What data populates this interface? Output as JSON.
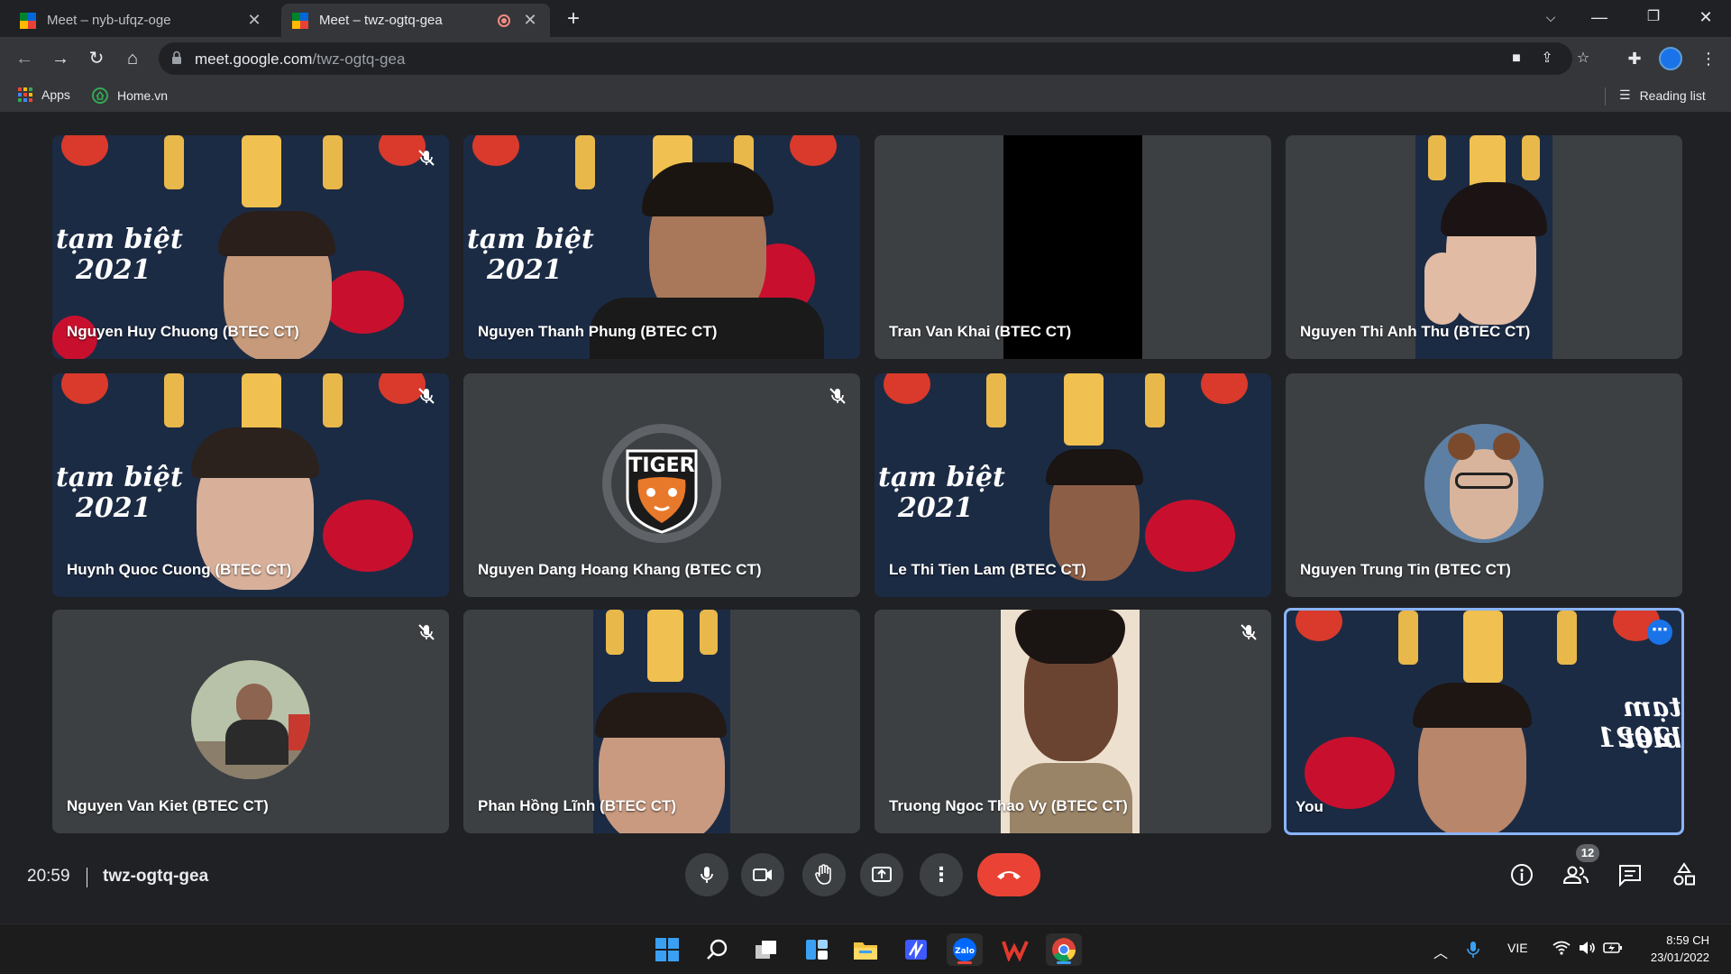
{
  "browser": {
    "tabs": [
      {
        "title": "Meet – nyb-ufqz-oge",
        "active": false
      },
      {
        "title": "Meet – twz-ogtq-gea",
        "active": true
      }
    ],
    "new_tab": "+",
    "url_host": "meet.google.com",
    "url_path": "/twz-ogtq-gea",
    "bookmarks": [
      {
        "label": "Apps"
      },
      {
        "label": "Home.vn"
      }
    ],
    "reading_list": "Reading list"
  },
  "meet": {
    "participants": [
      {
        "name": "Nguyen Huy Chuong (BTEC CT)",
        "muted": true,
        "kind": "festive"
      },
      {
        "name": "Nguyen Thanh Phung (BTEC CT)",
        "muted": false,
        "kind": "festive"
      },
      {
        "name": "Tran Van Khai (BTEC CT)",
        "muted": false,
        "kind": "black"
      },
      {
        "name": "Nguyen Thi Anh Thu (BTEC CT)",
        "muted": false,
        "kind": "narrow-festive"
      },
      {
        "name": "Huynh Quoc Cuong (BTEC CT)",
        "muted": true,
        "kind": "festive"
      },
      {
        "name": "Nguyen Dang Hoang Khang (BTEC CT)",
        "muted": true,
        "kind": "avatar-tiger"
      },
      {
        "name": "Le Thi Tien Lam (BTEC CT)",
        "muted": false,
        "kind": "festive"
      },
      {
        "name": "Nguyen Trung Tin (BTEC CT)",
        "muted": false,
        "kind": "avatar-photo"
      },
      {
        "name": "Nguyen Van Kiet (BTEC CT)",
        "muted": true,
        "kind": "avatar-photo"
      },
      {
        "name": "Phan Hồng Lĩnh (BTEC CT)",
        "muted": false,
        "kind": "narrow-festive"
      },
      {
        "name": "Truong Ngoc Thao Vy (BTEC CT)",
        "muted": true,
        "kind": "narrow-photo"
      },
      {
        "name": "You",
        "muted": false,
        "kind": "self"
      }
    ],
    "festive_text": [
      "tạm biệt",
      "2021"
    ],
    "tiger_logo_text": "TIGER",
    "clock": "20:59",
    "meeting_code": "twz-ogtq-gea",
    "participant_count": "12",
    "colors": {
      "accent": "#8ab4f8",
      "hangup": "#ea4335",
      "tile": "#3c4043",
      "background": "#202124"
    }
  },
  "taskbar": {
    "language": "VIE",
    "time": "8:59 CH",
    "date": "23/01/2022",
    "apps": [
      "start-icon",
      "search-icon",
      "task-view-icon",
      "widgets-icon",
      "file-explorer-icon",
      "app-icon",
      "zalo-icon",
      "wps-icon",
      "chrome-icon"
    ],
    "zalo_label": "Zalo"
  }
}
